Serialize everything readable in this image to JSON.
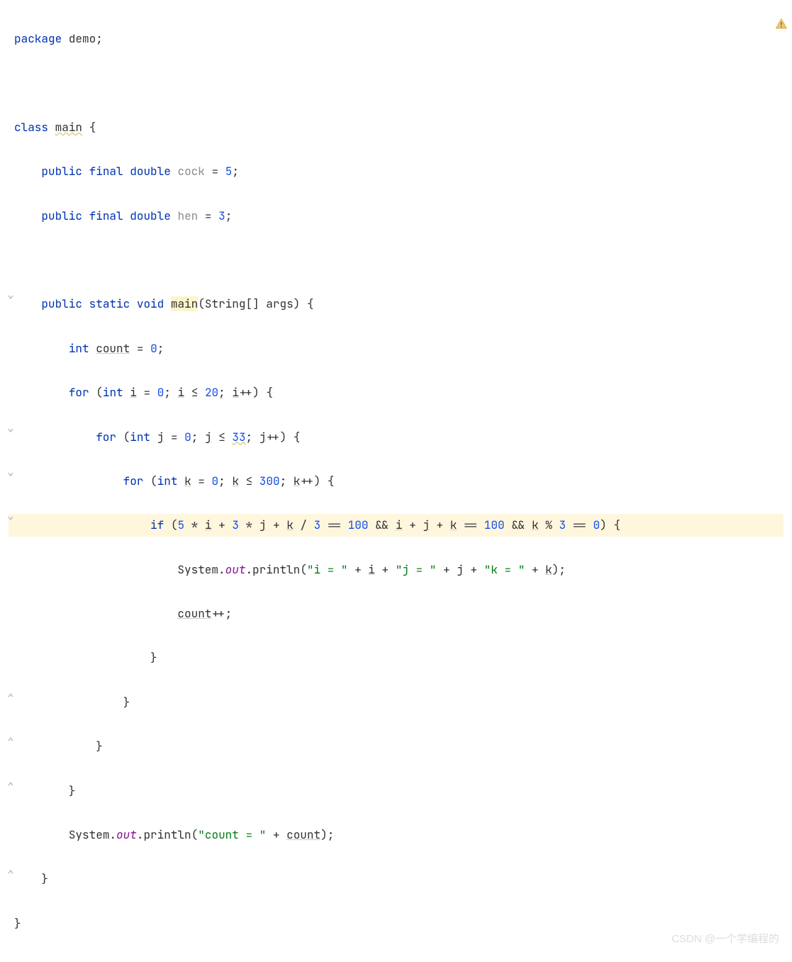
{
  "code": {
    "package_kw": "package",
    "package_name": "demo",
    "semicolon": ";",
    "class_kw": "class",
    "class_name": "main",
    "lbrace": "{",
    "rbrace": "}",
    "public_kw": "public",
    "final_kw": "final",
    "double_kw": "double",
    "static_kw": "static",
    "void_kw": "void",
    "int_kw": "int",
    "for_kw": "for",
    "if_kw": "if",
    "cock_field": "cock",
    "cock_val": "5",
    "hen_field": "hen",
    "hen_val": "3",
    "main_method": "main",
    "main_params": "(String[] args)",
    "count_var": "count",
    "zero": "0",
    "i_var": "i",
    "j_var": "j",
    "k_var": "k",
    "le": "≤",
    "twenty": "20",
    "thirtythree": "33",
    "threehundred": "300",
    "inc": "++",
    "rparen": ")",
    "lparen": "(",
    "eq": "=",
    "five": "5",
    "three": "3",
    "hundred": "100",
    "star": "*",
    "plus": "+",
    "slash": "/",
    "eqeq": "==",
    "andand": "&&",
    "percent": "%",
    "system": "System",
    "dot": ".",
    "out": "out",
    "println": "println",
    "str_i": "\"i = \"",
    "str_j": "\"j = \"",
    "str_k": "\"k = \"",
    "str_count": "\"count = \"",
    "count_inc": "count++;",
    "comma_space": " "
  },
  "watermark": "CSDN @一个学编程的",
  "icons": {
    "warning": "warning-icon"
  }
}
